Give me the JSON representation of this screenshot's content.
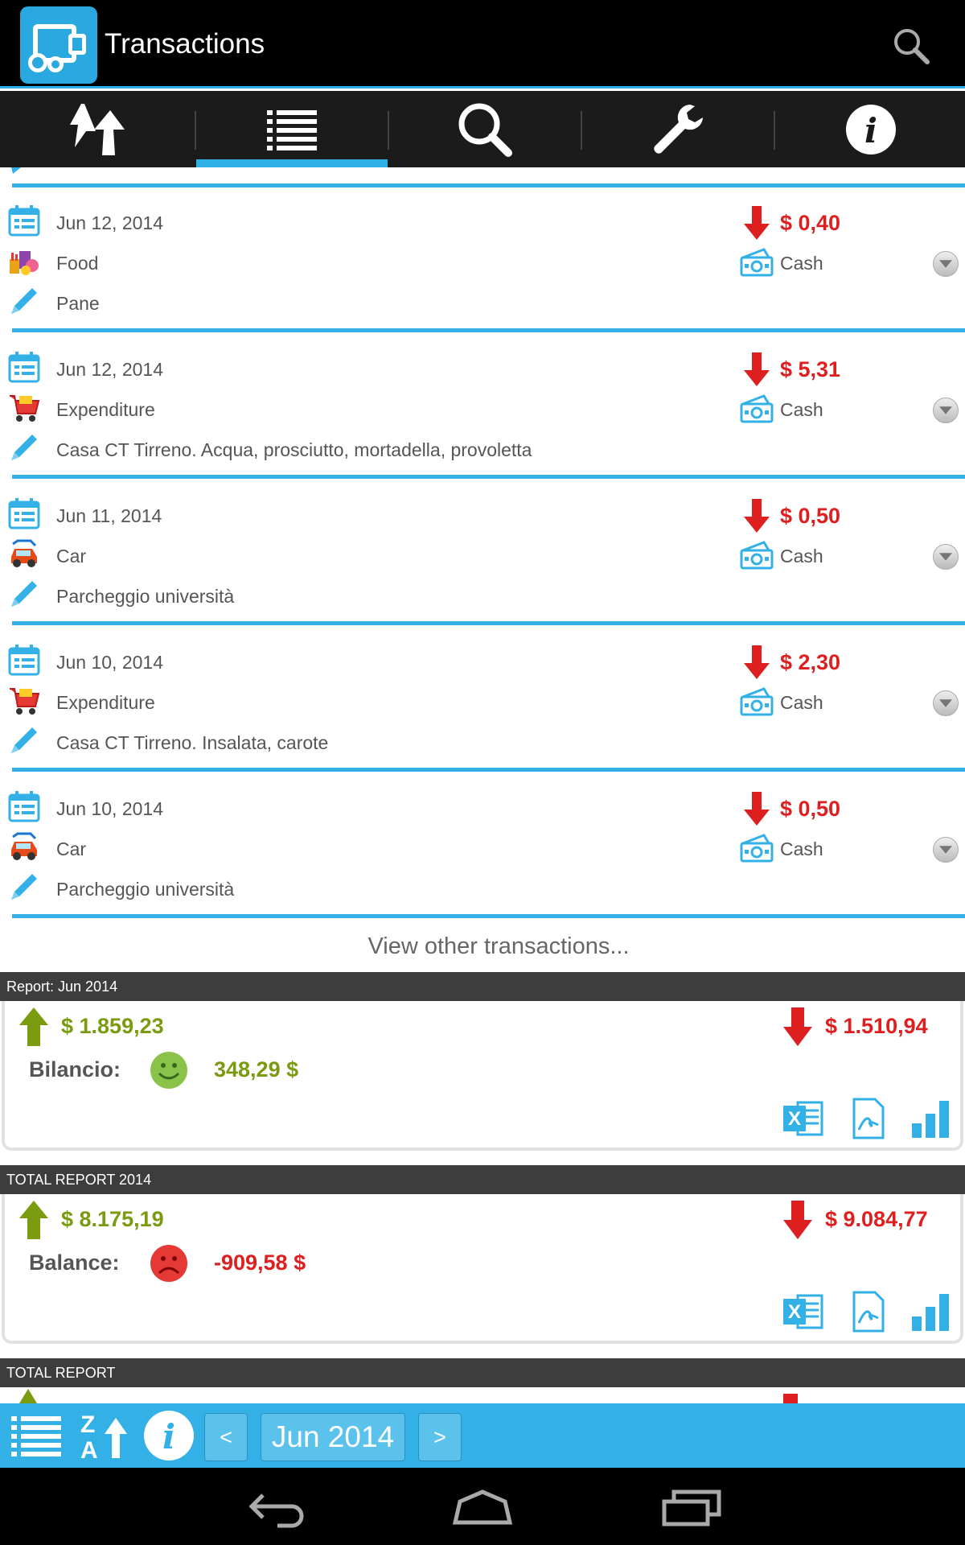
{
  "app": {
    "title": "Transactions"
  },
  "tabs": [
    {
      "icon": "sync-icon"
    },
    {
      "icon": "list-icon",
      "selected": true
    },
    {
      "icon": "search-icon"
    },
    {
      "icon": "wrench-icon"
    },
    {
      "icon": "info-icon"
    }
  ],
  "transactions": [
    {
      "date": "Jun 12, 2014",
      "category": "Food",
      "category_icon": "food-icon",
      "note": "Pane",
      "amount": "$ 0,40",
      "account": "Cash"
    },
    {
      "date": "Jun 12, 2014",
      "category": "Expenditure",
      "category_icon": "shopping-cart-icon",
      "note": "Casa CT Tirreno. Acqua, prosciutto, mortadella, provoletta",
      "amount": "$ 5,31",
      "account": "Cash"
    },
    {
      "date": "Jun 11, 2014",
      "category": "Car",
      "category_icon": "car-icon",
      "note": "Parcheggio università",
      "amount": "$ 0,50",
      "account": "Cash"
    },
    {
      "date": "Jun 10, 2014",
      "category": "Expenditure",
      "category_icon": "shopping-cart-icon",
      "note": "Casa CT Tirreno. Insalata, carote",
      "amount": "$ 2,30",
      "account": "Cash"
    },
    {
      "date": "Jun 10, 2014",
      "category": "Car",
      "category_icon": "car-icon",
      "note": "Parcheggio università",
      "amount": "$ 0,50",
      "account": "Cash"
    }
  ],
  "view_other": "View other transactions...",
  "reports": [
    {
      "header": "Report: Jun 2014",
      "income": "$ 1.859,23",
      "expense": "$ 1.510,94",
      "balance_label": "Bilancio:",
      "balance": "348,29 $",
      "mood": "happy",
      "balance_color": "#7a9a10"
    },
    {
      "header": "TOTAL REPORT 2014",
      "income": "$ 8.175,19",
      "expense": "$ 9.084,77",
      "balance_label": "Balance:",
      "balance": "-909,58 $",
      "mood": "sad",
      "balance_color": "#dd1f1f"
    },
    {
      "header": "TOTAL REPORT"
    }
  ],
  "bottom_bar": {
    "prev": "<",
    "month": "Jun 2014",
    "next": ">"
  },
  "colors": {
    "accent": "#33b1e6",
    "expense": "#dd1f1f",
    "income": "#7a9a10"
  }
}
